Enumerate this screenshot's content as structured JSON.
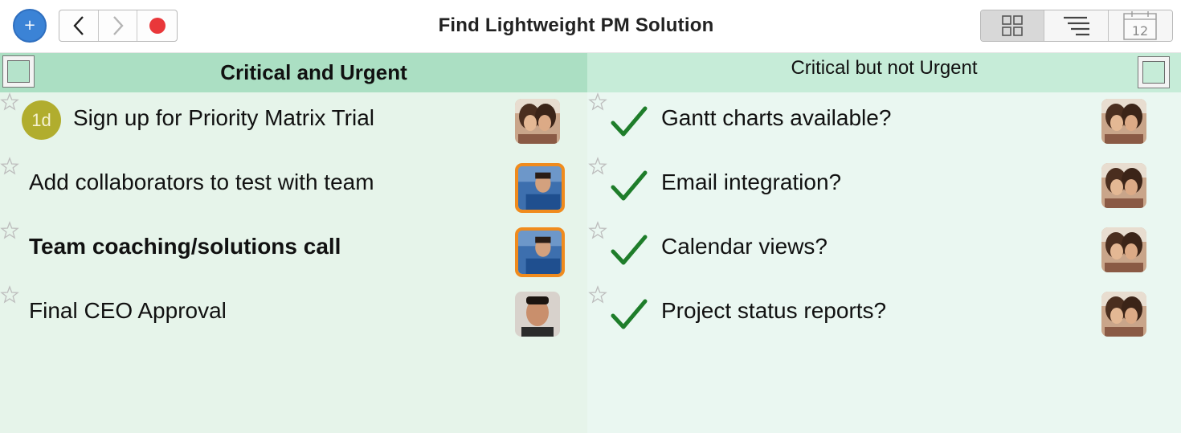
{
  "window": {
    "title": "Find Lightweight PM Solution"
  },
  "toolbar": {
    "add_icon": "+",
    "nav": [
      "back-chevron-icon",
      "forward-chevron-icon",
      "record-dot-icon"
    ],
    "views": [
      "grid-view-icon",
      "list-view-icon",
      "calendar-view-icon"
    ],
    "calendar_day": "12"
  },
  "quadrants": [
    {
      "title": "Critical and Urgent",
      "header_color": "#abdfc3",
      "body_color": "#e6f4ea",
      "tasks": [
        {
          "text": "Sign up for Priority Matrix Trial",
          "due_badge": "1d",
          "bold": false,
          "avatar": "woman-pair-photo",
          "avatar_selected": false
        },
        {
          "text": "Add collaborators to test with team",
          "bold": false,
          "avatar": "man-blue-shirt-photo",
          "avatar_selected": true
        },
        {
          "text": "Team coaching/solutions call",
          "bold": true,
          "avatar": "man-blue-shirt-photo",
          "avatar_selected": true
        },
        {
          "text": "Final CEO Approval",
          "bold": false,
          "avatar": "man-portrait-photo",
          "avatar_selected": false
        }
      ]
    },
    {
      "title": "Critical but not Urgent",
      "header_color": "#c6ecd8",
      "body_color": "#eaf7f1",
      "tasks": [
        {
          "text": "Gantt charts available?",
          "completed": true,
          "avatar": "woman-pair-photo"
        },
        {
          "text": "Email integration?",
          "completed": true,
          "avatar": "woman-pair-photo"
        },
        {
          "text": "Calendar views?",
          "completed": true,
          "avatar": "woman-pair-photo"
        },
        {
          "text": "Project status reports?",
          "completed": true,
          "avatar": "woman-pair-photo"
        }
      ]
    }
  ],
  "colors": {
    "accent_blue": "#3b83d6",
    "record_red": "#e9373a",
    "check_green": "#1e7d2a",
    "badge_olive": "#b1ad2e",
    "selection_orange": "#f08b1d"
  }
}
